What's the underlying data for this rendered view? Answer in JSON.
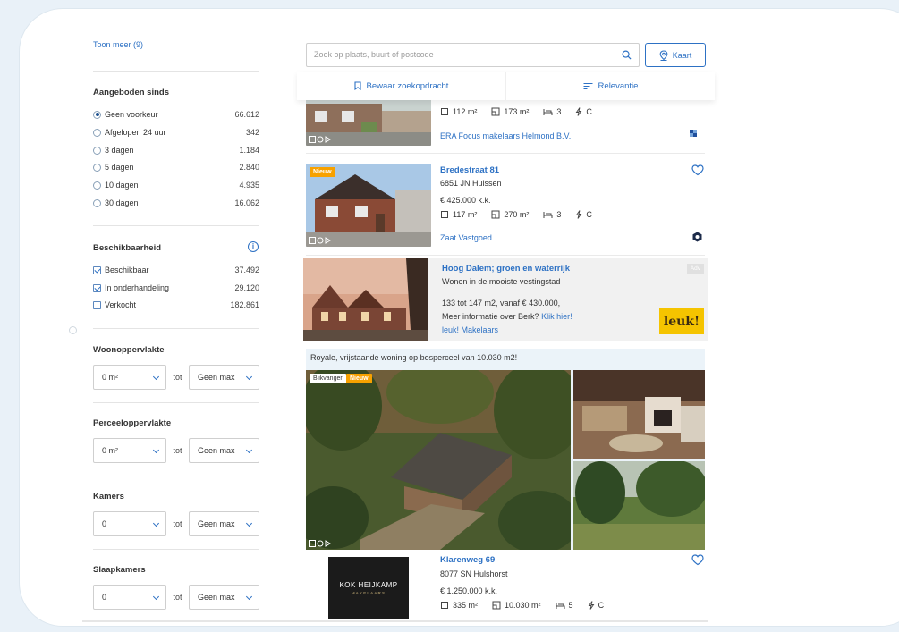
{
  "sidebar": {
    "show_more": "Toon meer (9)",
    "offered_since": {
      "title": "Aangeboden sinds",
      "options": [
        {
          "label": "Geen voorkeur",
          "count": "66.612",
          "selected": true
        },
        {
          "label": "Afgelopen 24 uur",
          "count": "342",
          "selected": false
        },
        {
          "label": "3 dagen",
          "count": "1.184",
          "selected": false
        },
        {
          "label": "5 dagen",
          "count": "2.840",
          "selected": false
        },
        {
          "label": "10 dagen",
          "count": "4.935",
          "selected": false
        },
        {
          "label": "30 dagen",
          "count": "16.062",
          "selected": false
        }
      ]
    },
    "availability": {
      "title": "Beschikbaarheid",
      "options": [
        {
          "label": "Beschikbaar",
          "count": "37.492",
          "checked": true
        },
        {
          "label": "In onderhandeling",
          "count": "29.120",
          "checked": true
        },
        {
          "label": "Verkocht",
          "count": "182.861",
          "checked": false
        }
      ]
    },
    "ranges": [
      {
        "title": "Woonoppervlakte",
        "min": "0 m²",
        "max": "Geen max"
      },
      {
        "title": "Perceeloppervlakte",
        "min": "0 m²",
        "max": "Geen max"
      },
      {
        "title": "Kamers",
        "min": "0",
        "max": "Geen max"
      },
      {
        "title": "Slaapkamers",
        "min": "0",
        "max": "Geen max"
      }
    ],
    "to_label": "tot"
  },
  "search": {
    "placeholder": "Zoek op plaats, buurt of postcode"
  },
  "map_button": "Kaart",
  "toolbar": {
    "save_search": "Bewaar zoekopdracht",
    "sort": "Relevantie"
  },
  "listings": [
    {
      "living_area": "112 m²",
      "plot_area": "173 m²",
      "rooms": "3",
      "energy": "C",
      "agent": "ERA Focus makelaars Helmond B.V."
    },
    {
      "badge": "Nieuw",
      "address": "Bredestraat 81",
      "zip": "6851 JN Huissen",
      "price": "€ 425.000 k.k.",
      "living_area": "117 m²",
      "plot_area": "270 m²",
      "rooms": "3",
      "energy": "C",
      "agent": "Zaat Vastgoed"
    }
  ],
  "promo": {
    "title": "Hoog Dalem; groen en waterrijk",
    "subtitle": "Wonen in de mooiste vestingstad",
    "line1": "133 tot 147 m2, vanaf € 430.000,",
    "line2": "Meer informatie over Berk?",
    "link": "Klik hier!",
    "agent": "leuk! Makelaars",
    "ad_label": "Adv",
    "logo_text": "leuk!"
  },
  "featured": {
    "caption": "Royale, vrijstaande woning op bosperceel van 10.030 m2!",
    "badges": [
      "Blikvanger",
      "Nieuw"
    ],
    "address": "Klarenweg 69",
    "zip": "8077 SN Hulshorst",
    "price": "€ 1.250.000 k.k.",
    "living_area": "335 m²",
    "plot_area": "10.030 m²",
    "rooms": "5",
    "energy": "C",
    "logo_main": "KOK HEIJKAMP",
    "logo_sub": "MAKELAARS"
  },
  "colors": {
    "link": "#2d71c4",
    "badge_new": "#f7a100",
    "ad_logo": "#f5c400"
  }
}
